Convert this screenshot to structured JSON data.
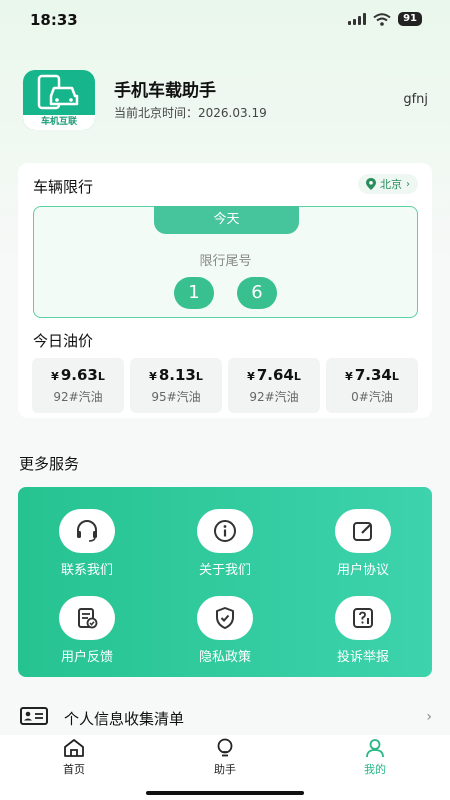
{
  "status": {
    "time": "18:33",
    "battery": "91"
  },
  "header": {
    "logo_text": "车机互联",
    "title": "手机车载助手",
    "time_label": "当前北京时间：",
    "time_value": "2026.03.19",
    "username": "gfnj"
  },
  "restriction": {
    "title": "车辆限行",
    "city": "北京",
    "today_label": "今天",
    "tail_label": "限行尾号",
    "numbers": [
      "1",
      "6"
    ]
  },
  "oil": {
    "title": "今日油价",
    "currency": "¥",
    "unit": "L",
    "items": [
      {
        "price": "9.63",
        "name": "92#汽油"
      },
      {
        "price": "8.13",
        "name": "95#汽油"
      },
      {
        "price": "7.64",
        "name": "92#汽油"
      },
      {
        "price": "7.34",
        "name": "0#汽油"
      }
    ]
  },
  "services": {
    "title": "更多服务",
    "items": [
      {
        "label": "联系我们",
        "icon": "headset-icon"
      },
      {
        "label": "关于我们",
        "icon": "info-icon"
      },
      {
        "label": "用户协议",
        "icon": "edit-document-icon"
      },
      {
        "label": "用户反馈",
        "icon": "feedback-icon"
      },
      {
        "label": "隐私政策",
        "icon": "shield-check-icon"
      },
      {
        "label": "投诉举报",
        "icon": "report-icon"
      }
    ]
  },
  "privacy_list": {
    "label": "个人信息收集清单"
  },
  "tabbar": {
    "items": [
      {
        "label": "首页",
        "icon": "home-icon"
      },
      {
        "label": "助手",
        "icon": "bulb-icon"
      },
      {
        "label": "我的",
        "icon": "user-icon"
      }
    ],
    "active": "我的"
  },
  "colors": {
    "accent": "#27b884",
    "panel_start": "#26c390",
    "panel_end": "#3dd3ad"
  }
}
